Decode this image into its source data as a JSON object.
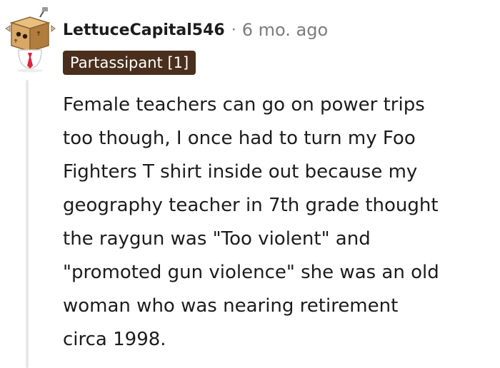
{
  "comment": {
    "author": "LettuceCapital546",
    "separator": "·",
    "timestamp": "6 mo. ago",
    "flair": "Partassipant [1]",
    "body": "Female teachers can go on power trips\ntoo though, I once had to turn my Foo\nFighters T shirt inside out because my\ngeography teacher in 7th grade thought\nthe raygun was \"Too violent\" and\n\"promoted gun violence\" she was an old\nwoman who was nearing retirement\ncirca 1998."
  },
  "avatar": {
    "icon": "snoo-box-head-avatar-icon",
    "colors": {
      "box": "#d9a766",
      "box_dark": "#b07d3e",
      "face": "#ffffff",
      "tie": "#e0243a"
    }
  },
  "colors": {
    "text": "#1c1c1c",
    "meta": "#7c7c7c",
    "flair_bg": "#4a2f1d",
    "flair_text": "#ffffff",
    "thread_line": "#e8e8e8"
  }
}
